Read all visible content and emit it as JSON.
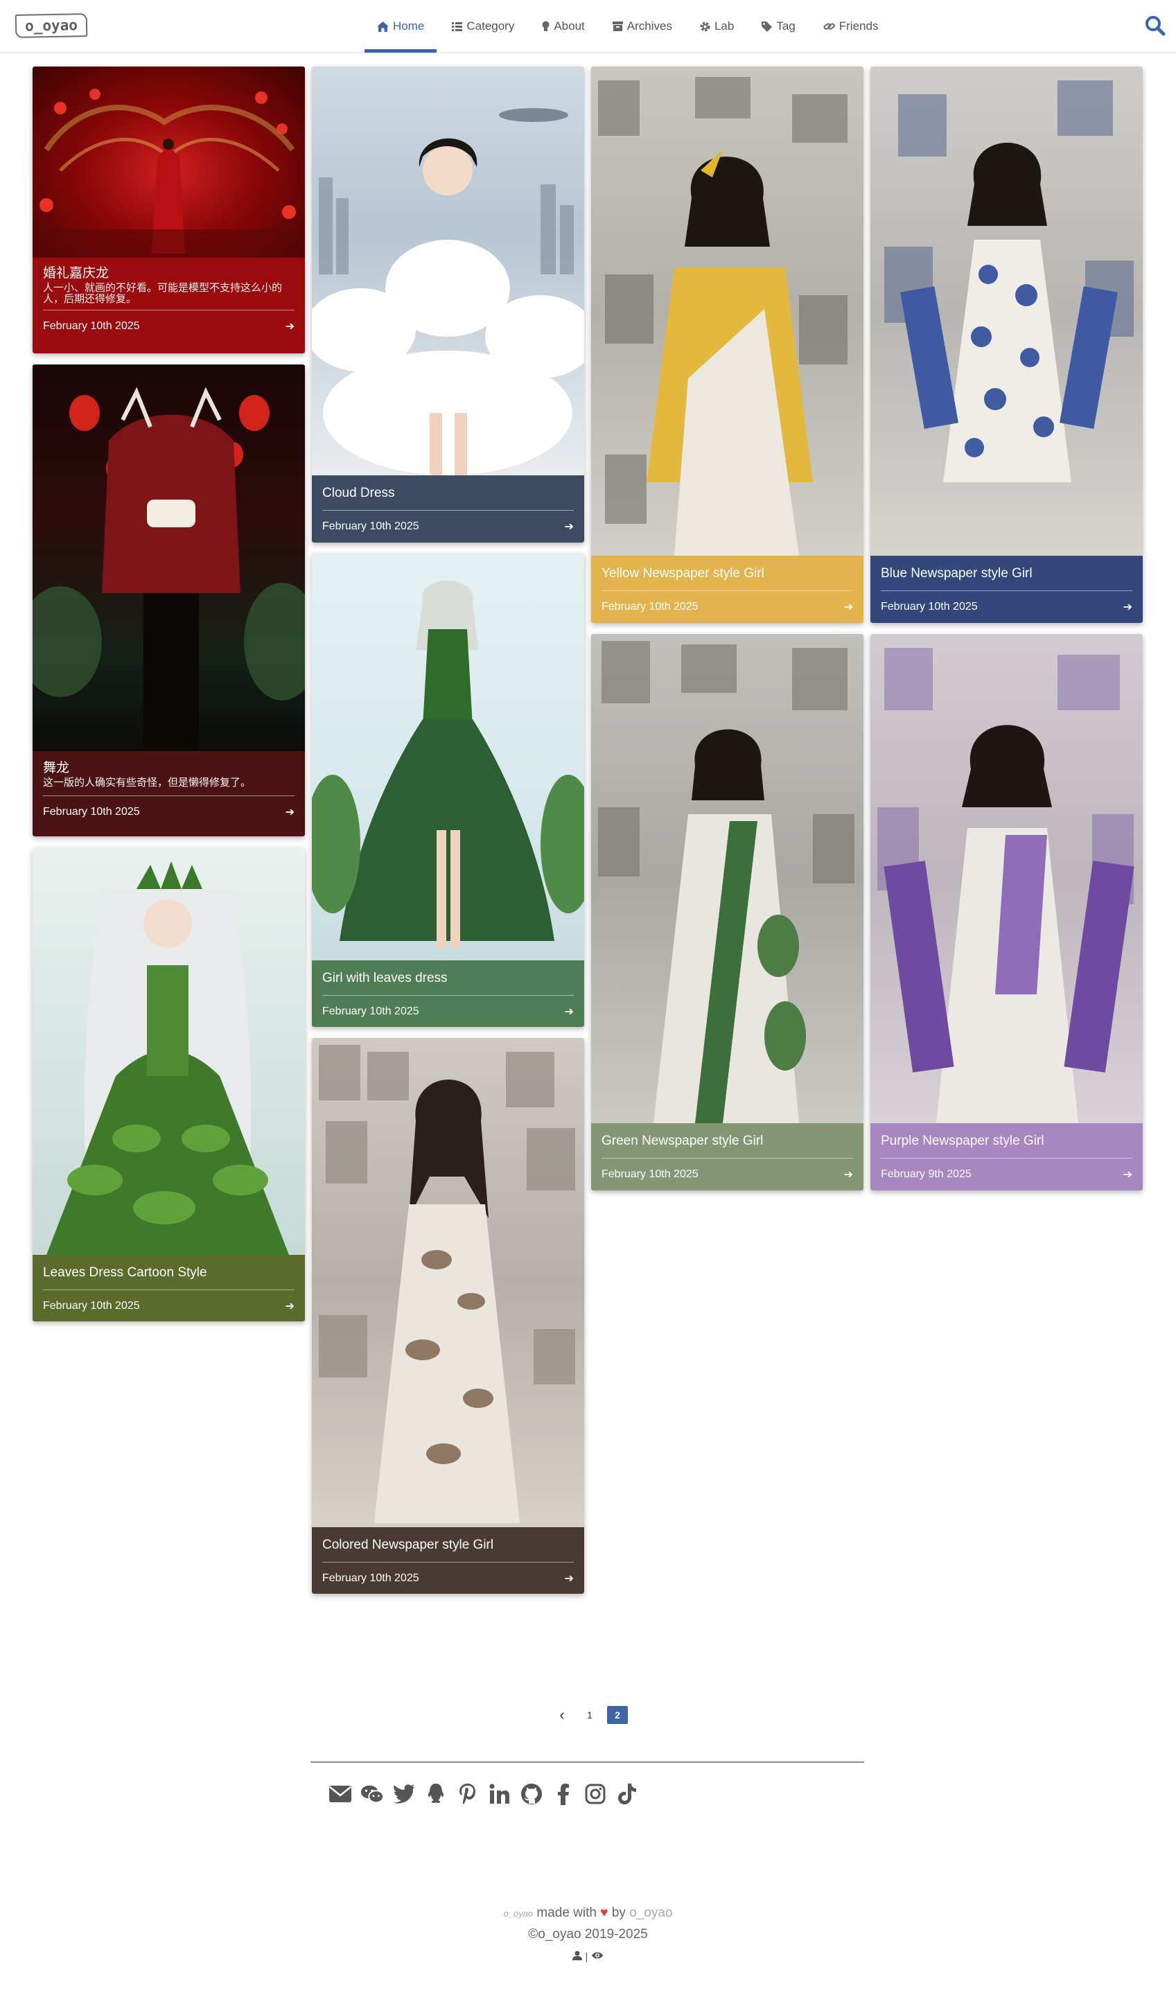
{
  "header": {
    "logo_text": "o_oyao",
    "nav": [
      {
        "label": "Home",
        "icon": "home-icon",
        "active": true
      },
      {
        "label": "Category",
        "icon": "list-icon"
      },
      {
        "label": "About",
        "icon": "bulb-icon"
      },
      {
        "label": "Archives",
        "icon": "archive-icon"
      },
      {
        "label": "Lab",
        "icon": "gear-icon"
      },
      {
        "label": "Tag",
        "icon": "tag-icon"
      },
      {
        "label": "Friends",
        "icon": "link-icon"
      }
    ],
    "search_icon": "search-icon"
  },
  "posts": [
    {
      "title": "婚礼嘉庆龙",
      "desc": "人一小、就画的不好看。可能是模型不支持这么小的人，后期还得修复。",
      "date": "February 10th 2025",
      "color": "#9b0a0c"
    },
    {
      "title": "舞龙",
      "desc": "这一版的人确实有些奇怪，但是懒得修复了。",
      "date": "February 10th 2025",
      "color": "#4c1313"
    },
    {
      "title": "Leaves Dress Cartoon Style",
      "date": "February 10th 2025",
      "color": "#5a6b2c"
    },
    {
      "title": "Cloud Dress",
      "date": "February 10th 2025",
      "color": "#3c4a62"
    },
    {
      "title": "Girl with leaves dress",
      "date": "February 10th 2025",
      "color": "#4f7d55"
    },
    {
      "title": "Colored Newspaper style Girl",
      "date": "February 10th 2025",
      "color": "#473b34"
    },
    {
      "title": "Yellow Newspaper style Girl",
      "date": "February 10th 2025",
      "color": "#e3b44e"
    },
    {
      "title": "Green Newspaper style Girl",
      "date": "February 10th 2025",
      "color": "#859675"
    },
    {
      "title": "Blue Newspaper style Girl",
      "date": "February 10th 2025",
      "color": "#33477c"
    },
    {
      "title": "Purple Newspaper style Girl",
      "date": "February 9th 2025",
      "color": "#a887c0"
    }
  ],
  "pagination": {
    "prev": "‹",
    "pages": [
      "1",
      "2"
    ],
    "current": "2"
  },
  "social_icons": [
    "mail-icon",
    "wechat-icon",
    "twitter-icon",
    "qq-icon",
    "pinterest-icon",
    "linkedin-icon",
    "github-icon",
    "facebook-icon",
    "instagram-icon",
    "tiktok-icon"
  ],
  "footer": {
    "signature": "o_oyao",
    "made_with": "made with",
    "by": "by",
    "author": "o_oyao",
    "copyright": "©o_oyao 2019-2025"
  }
}
